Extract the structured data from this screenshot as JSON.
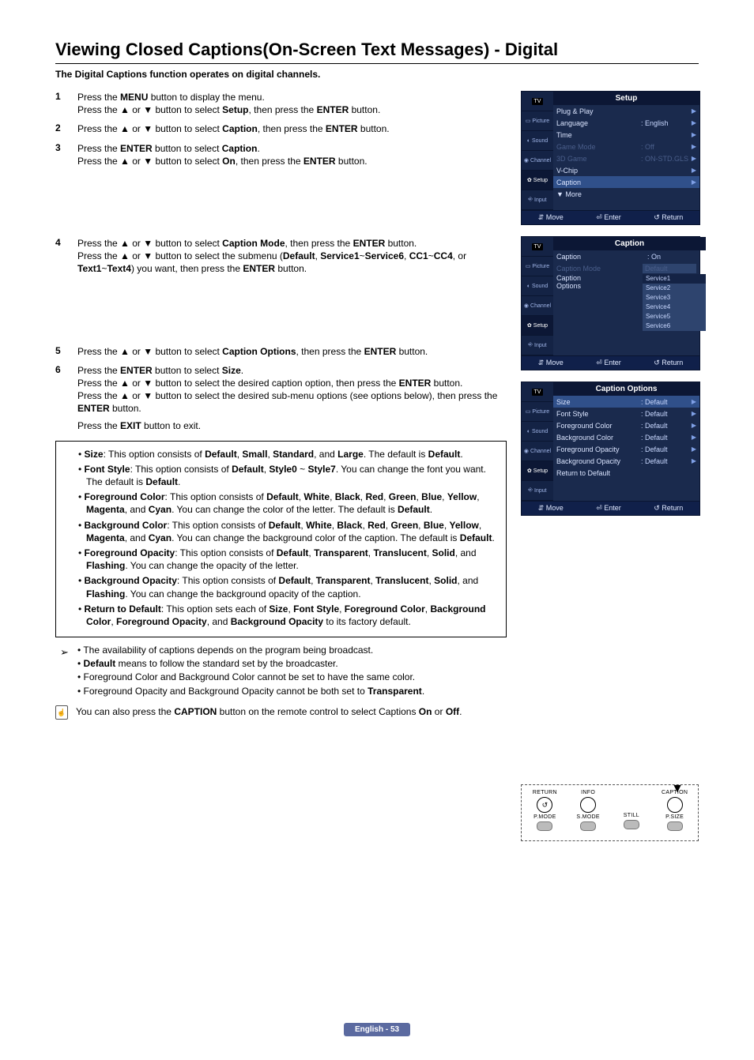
{
  "title": "Viewing Closed Captions(On-Screen Text Messages) - Digital",
  "intro": "The Digital Captions function operates on digital channels.",
  "steps": {
    "s1a": "Press the MENU button to display the menu.",
    "s1b": "Press the ▲ or ▼ button to select Setup, then press the ENTER button.",
    "s2": "Press the ▲ or ▼ button to select Caption, then press the ENTER button.",
    "s3a": "Press the ENTER button to select Caption.",
    "s3b": "Press the ▲ or ▼ button to select On, then press the ENTER button.",
    "s4a": "Press the ▲ or ▼ button to select Caption Mode, then press the ENTER button.",
    "s4b": "Press the ▲ or ▼ button to select the submenu (Default, Service1~Service6, CC1~CC4, or Text1~Text4) you want, then press the ENTER button.",
    "s5": "Press the ▲ or ▼ button to select Caption Options, then press the ENTER button.",
    "s6a": "Press the ENTER button to select Size.",
    "s6b": "Press the ▲ or ▼ button to select the desired caption option, then press the ENTER button.",
    "s6c": "Press the ▲ or ▼ button to select the desired sub-menu options (see options below), then press the ENTER button.",
    "s6d": "Press the EXIT button to exit."
  },
  "options": {
    "size": "Size: This option consists of Default, Small, Standard, and Large. The default is Default.",
    "font": "Font Style: This option consists of Default, Style0 ~ Style7. You can change the font you want. The default is Default.",
    "fg": "Foreground Color: This option consists of Default, White, Black, Red, Green, Blue, Yellow, Magenta, and Cyan. You can change the color of the letter. The default is Default.",
    "bg": "Background Color: This option consists of Default, White, Black, Red, Green, Blue, Yellow, Magenta, and Cyan. You can change the background color of the caption. The default is Default.",
    "fgo": "Foreground Opacity: This option consists of Default, Transparent, Translucent, Solid, and Flashing. You can change the opacity of the letter.",
    "bgo": "Background Opacity: This option consists of Default, Transparent, Translucent, Solid, and Flashing. You can change the background opacity of the caption.",
    "rtd": "Return to Default: This option sets each of Size, Font Style, Foreground Color, Background Color, Foreground Opacity, and Background Opacity to its factory default."
  },
  "notes": {
    "n1": "The availability of captions depends on the program being broadcast.",
    "n2": "Default means to follow the standard set by the broadcaster.",
    "n3": "Foreground Color and Background Color cannot be set to have the same color.",
    "n4": "Foreground Opacity and Background Opacity cannot be both set to Transparent."
  },
  "remark": "You can also press the CAPTION button on the remote control to select Captions On or Off.",
  "osd": {
    "tabs": {
      "tv": "TV",
      "picture": "Picture",
      "sound": "Sound",
      "channel": "Channel",
      "setup": "Setup",
      "input": "Input"
    },
    "footer": {
      "move": "Move",
      "enter": "Enter",
      "return": "Return"
    },
    "setup": {
      "title": "Setup",
      "rows": {
        "plug": "Plug & Play",
        "lang": "Language",
        "lang_v": ": English",
        "time": "Time",
        "game": "Game Mode",
        "game_v": ": Off",
        "d3": "3D Game",
        "d3_v": ": ON-STD.GLS",
        "vchip": "V-Chip",
        "caption": "Caption",
        "more": "▼ More"
      }
    },
    "caption": {
      "title": "Caption",
      "rows": {
        "cap": "Caption",
        "cap_v": ": On",
        "mode": "Caption Mode",
        "mode_v": "Default",
        "opts": "Caption Options"
      },
      "list": {
        "s1": "Service1",
        "s2": "Service2",
        "s3": "Service3",
        "s4": "Service4",
        "s5": "Service5",
        "s6": "Service6"
      }
    },
    "copts": {
      "title": "Caption Options",
      "rows": {
        "size": "Size",
        "font": "Font Style",
        "fg": "Foreground Color",
        "bg": "Background Color",
        "fgo": "Foreground Opacity",
        "bgo": "Background Opacity",
        "rtd": "Return to Default",
        "def": ": Default"
      }
    }
  },
  "remote": {
    "return": "RETURN",
    "info": "INFO",
    "caption": "CAPTION",
    "pmode": "P.MODE",
    "smode": "S.MODE",
    "still": "STILL",
    "psize": "P.SIZE"
  },
  "footer_text": "English - 53"
}
